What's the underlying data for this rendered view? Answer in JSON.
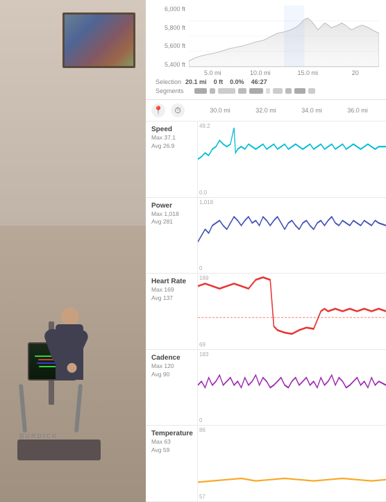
{
  "photo": {
    "equipment_brand": "BURDICK"
  },
  "elevation": {
    "y_labels": [
      "6,000 ft",
      "5,800 ft",
      "5,600 ft",
      "5,400 ft"
    ],
    "x_labels": [
      "5.0 mi",
      "10.0 mi",
      "15.0 mi",
      "20"
    ],
    "selection_label": "Selection",
    "selection_values": [
      "20.1 mi",
      "0 ft",
      "0.0%",
      "46:27"
    ],
    "segments_label": "Segments"
  },
  "controls": {
    "mile_markers": [
      "30.0 mi",
      "32.0 mi",
      "34.0 mi",
      "36.0 mi"
    ]
  },
  "metrics": [
    {
      "name": "Speed",
      "max_label": "Max 37.1",
      "avg_label": "Avg 26.9",
      "color": "#00bcd4",
      "y_top": "49.2",
      "y_bottom": "0.0",
      "chart_type": "speed"
    },
    {
      "name": "Power",
      "max_label": "Max 1,018",
      "avg_label": "Avg 281",
      "color": "#3f51b5",
      "y_top": "1,018",
      "y_bottom": "0",
      "chart_type": "power"
    },
    {
      "name": "Heart Rate",
      "max_label": "Max 169",
      "avg_label": "Avg 137",
      "color": "#e53935",
      "y_top": "169",
      "y_bottom": "69",
      "chart_type": "heartrate"
    },
    {
      "name": "Cadence",
      "max_label": "Max 120",
      "avg_label": "Avg 90",
      "color": "#9c27b0",
      "y_top": "183",
      "y_bottom": "0",
      "chart_type": "cadence"
    },
    {
      "name": "Temperature",
      "max_label": "Max 63",
      "avg_label": "Avg 59",
      "color": "#f9a825",
      "y_top": "86",
      "y_bottom": "57",
      "chart_type": "temperature"
    }
  ],
  "icons": {
    "location_pin": "📍",
    "clock": "🕐"
  }
}
